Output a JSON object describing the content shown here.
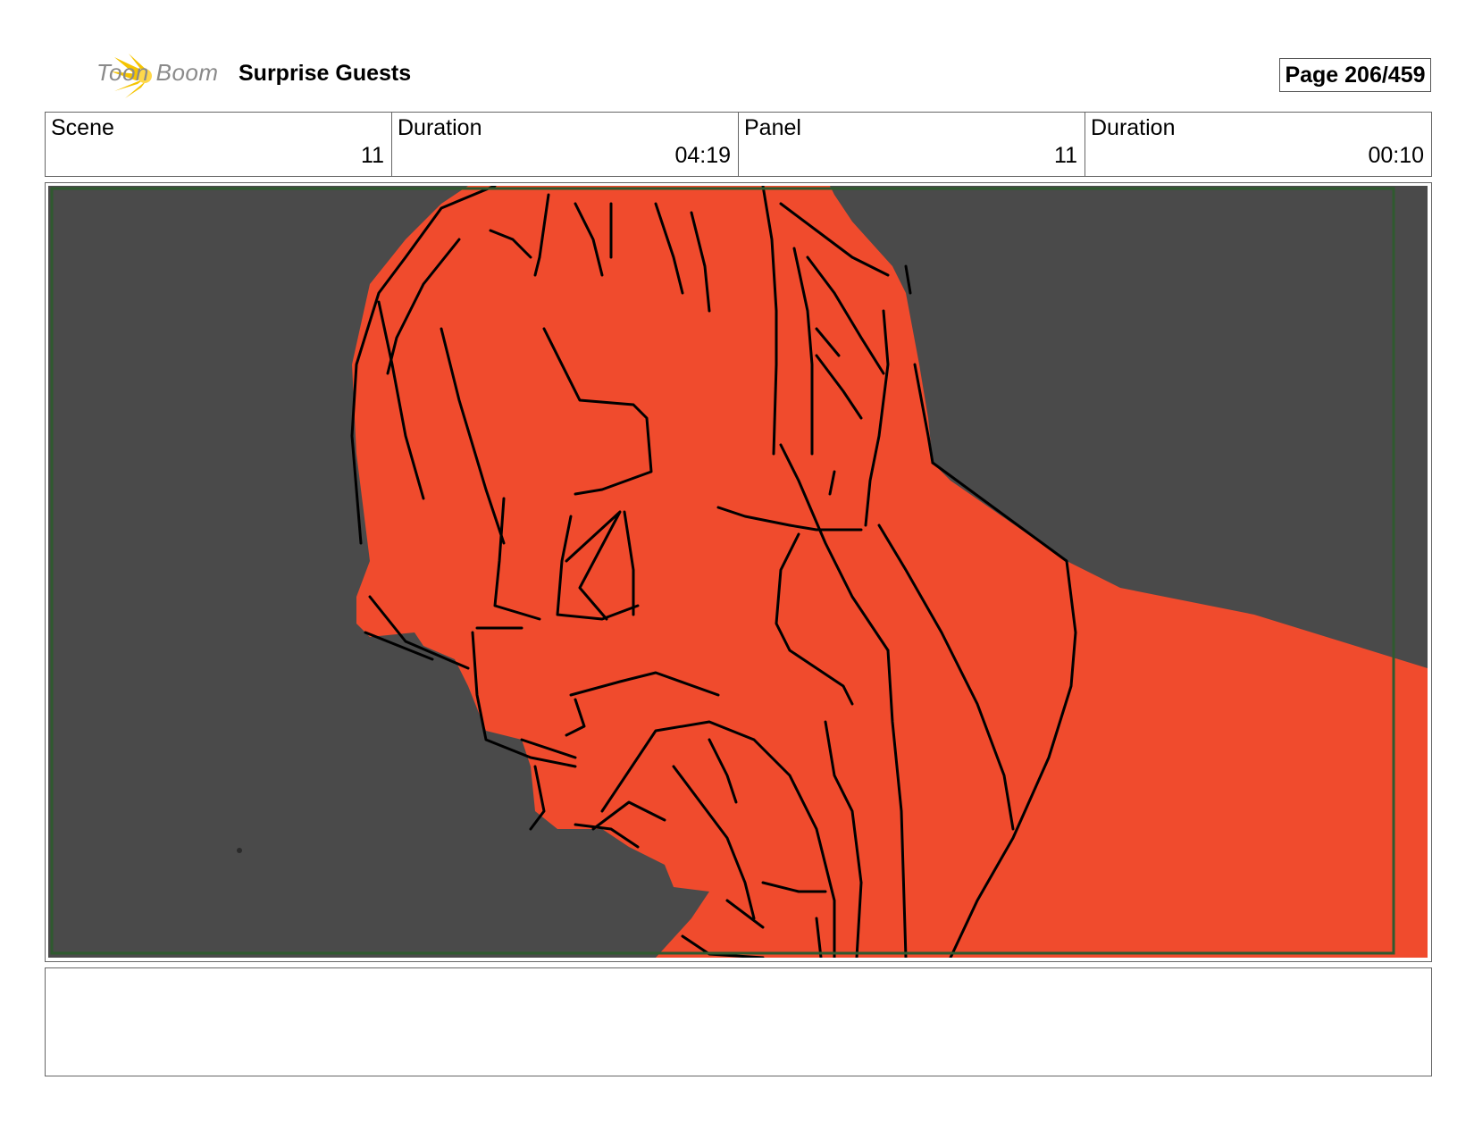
{
  "header": {
    "logo_text": "Toon Boom",
    "project_title": "Surprise Guests",
    "page_label": "Page 206/459"
  },
  "info": {
    "scene_label": "Scene",
    "scene_value": "11",
    "scene_duration_label": "Duration",
    "scene_duration_value": "04:19",
    "panel_label": "Panel",
    "panel_value": "11",
    "panel_duration_label": "Duration",
    "panel_duration_value": "00:10"
  },
  "colors": {
    "background_gray": "#4a4a4a",
    "character_red": "#f04b2d",
    "safe_frame_green": "#2f5a2f",
    "logo_yellow": "#f5c400"
  },
  "notes": {
    "text": ""
  }
}
